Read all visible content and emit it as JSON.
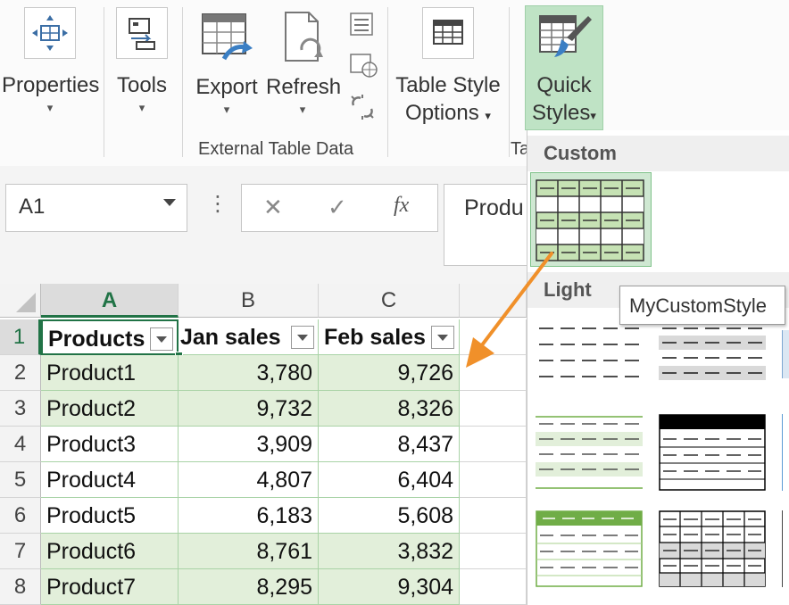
{
  "ribbon": {
    "properties_label": "Properties",
    "tools_label": "Tools",
    "export_label": "Export",
    "refresh_label": "Refresh",
    "external_table_data_label": "External Table Data",
    "table_style_options_line1": "Table Style",
    "table_style_options_line2": "Options",
    "quick_styles_line1": "Quick",
    "quick_styles_line2": "Styles",
    "table_styles_group_partial": "Ta",
    "dropdown_caret": "▾"
  },
  "formula_bar": {
    "name_box_value": "A1",
    "more_icon": "⋮",
    "cancel_icon": "✕",
    "enter_icon": "✓",
    "fx_label": "fx",
    "content_partial": "Produ"
  },
  "sheet": {
    "columns": [
      "A",
      "B",
      "C"
    ],
    "row_numbers": [
      "1",
      "2",
      "3",
      "4",
      "5",
      "6",
      "7",
      "8"
    ],
    "headers": [
      "Products",
      "Jan sales",
      "Feb sales"
    ],
    "rows": [
      [
        "Product1",
        "3,780",
        "9,726"
      ],
      [
        "Product2",
        "9,732",
        "8,326"
      ],
      [
        "Product3",
        "3,909",
        "8,437"
      ],
      [
        "Product4",
        "4,807",
        "6,404"
      ],
      [
        "Product5",
        "6,183",
        "5,608"
      ],
      [
        "Product6",
        "8,761",
        "3,832"
      ],
      [
        "Product7",
        "8,295",
        "9,304"
      ]
    ]
  },
  "gallery": {
    "custom_section": "Custom",
    "light_section": "Light",
    "tooltip": "MyCustomStyle"
  },
  "colors": {
    "accent_green": "#217346",
    "band_green": "#e2efda",
    "highlight_green": "#bfe3c5",
    "arrow_orange": "#f0902a"
  }
}
